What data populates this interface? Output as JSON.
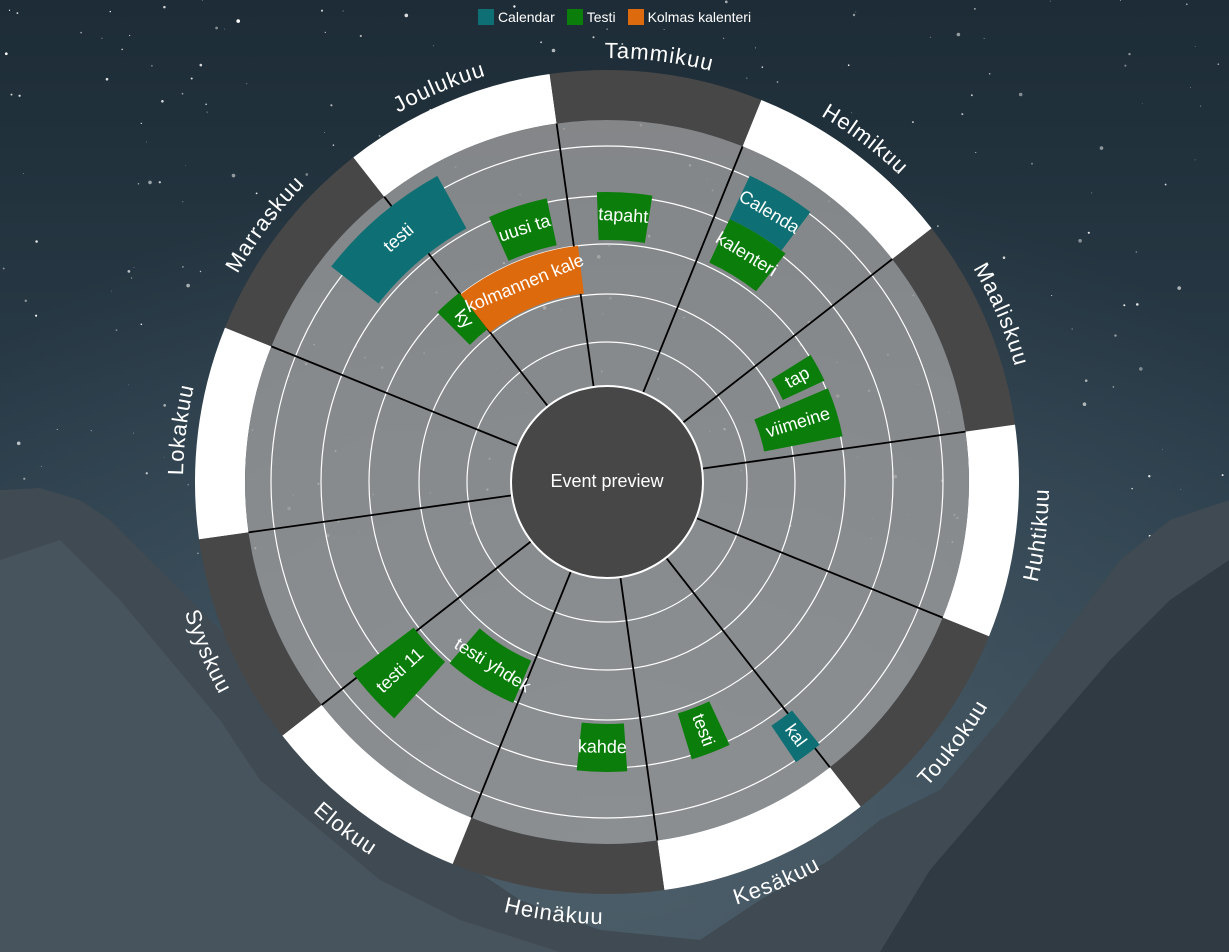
{
  "legend": [
    {
      "label": "Calendar",
      "color": "#0e7074"
    },
    {
      "label": "Testi",
      "color": "#0a7d0a"
    },
    {
      "label": "Kolmas kalenteri",
      "color": "#dd6a0d"
    }
  ],
  "center": {
    "label": "Event preview"
  },
  "months": [
    "Lokakuu",
    "Marraskuu",
    "Joulukuu",
    "Tammikuu",
    "Helmikuu",
    "Maaliskuu",
    "Huhtikuu",
    "Toukokuu",
    "Kesäkuu",
    "Heinäkuu",
    "Elokuu",
    "Syyskuu"
  ],
  "events": [
    {
      "label": "testi",
      "calendar": "Calendar",
      "color": "#0e7074"
    },
    {
      "label": "uusi ta",
      "calendar": "Testi",
      "color": "#0a7d0a"
    },
    {
      "label": "ky",
      "calendar": "Testi",
      "color": "#0a7d0a"
    },
    {
      "label": "kolmannen kale",
      "calendar": "Kolmas kalenteri",
      "color": "#dd6a0d"
    },
    {
      "label": "tapaht",
      "calendar": "Testi",
      "color": "#0a7d0a"
    },
    {
      "label": "Calenda",
      "calendar": "Calendar",
      "color": "#0e7074"
    },
    {
      "label": "kalenteri",
      "calendar": "Testi",
      "color": "#0a7d0a"
    },
    {
      "label": "tap",
      "calendar": "Testi",
      "color": "#0a7d0a"
    },
    {
      "label": "viimeine",
      "calendar": "Testi",
      "color": "#0a7d0a"
    },
    {
      "label": "testi 11",
      "calendar": "Testi",
      "color": "#0a7d0a"
    },
    {
      "label": "testi yhdek",
      "calendar": "Testi",
      "color": "#0a7d0a"
    },
    {
      "label": "kahde",
      "calendar": "Testi",
      "color": "#0a7d0a"
    },
    {
      "label": "testi",
      "calendar": "Testi",
      "color": "#0a7d0a"
    },
    {
      "label": "kal",
      "calendar": "Calendar",
      "color": "#0e7074"
    }
  ]
}
